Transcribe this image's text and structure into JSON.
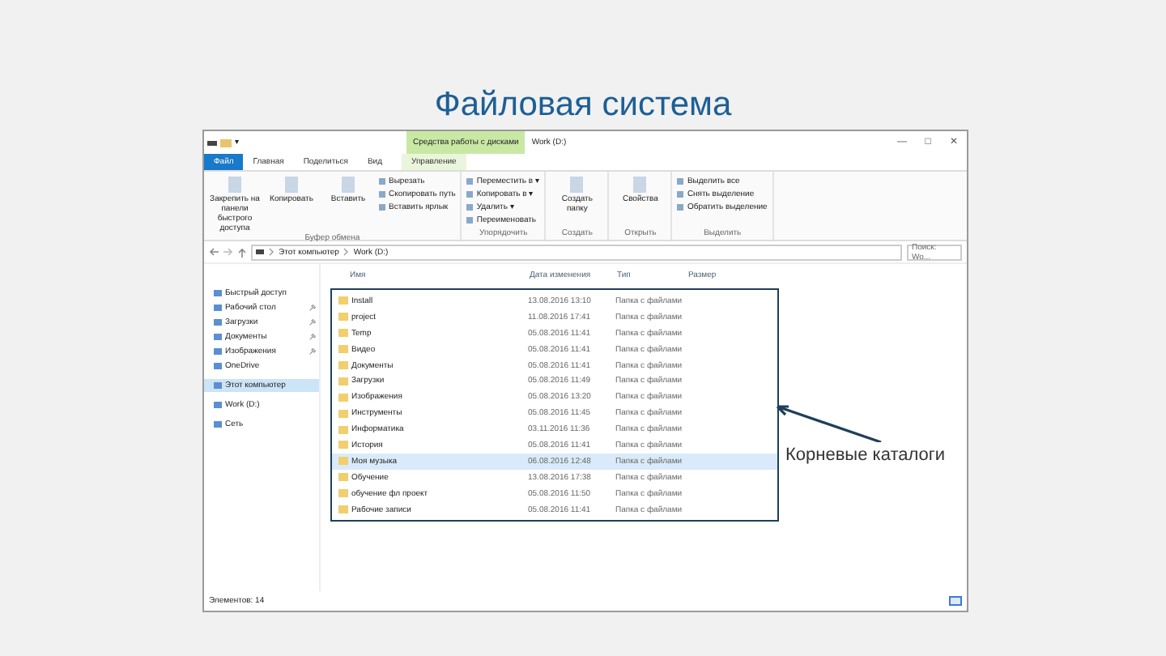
{
  "slide_title": "Файловая система",
  "window": {
    "quick_access": "▾",
    "context_tab": "Средства работы с дисками",
    "title": "Work (D:)",
    "controls": [
      "—",
      "□",
      "✕"
    ]
  },
  "tabs": [
    {
      "label": "Файл",
      "selected": true
    },
    {
      "label": "Главная",
      "selected": false
    },
    {
      "label": "Поделиться",
      "selected": false
    },
    {
      "label": "Вид",
      "selected": false
    },
    {
      "label": "Управление",
      "selected": false
    }
  ],
  "ribbon": [
    {
      "group": "Буфер обмена",
      "large": [
        "Закрепить на панели быстрого доступа",
        "Копировать",
        "Вставить"
      ],
      "small": [
        "Вырезать",
        "Скопировать путь",
        "Вставить ярлык"
      ]
    },
    {
      "group": "Упорядочить",
      "small": [
        "Переместить в ▾",
        "Копировать в ▾",
        "Удалить ▾",
        "Переименовать"
      ]
    },
    {
      "group": "Создать",
      "large": [
        "Создать папку"
      ]
    },
    {
      "group": "Открыть",
      "large": [
        "Свойства"
      ]
    },
    {
      "group": "Выделить",
      "small": [
        "Выделить все",
        "Снять выделение",
        "Обратить выделение"
      ]
    }
  ],
  "address": {
    "path": [
      "Этот компьютер",
      "Work (D:)"
    ],
    "search_placeholder": "Поиск: Wo..."
  },
  "navigation": [
    {
      "label": "Быстрый доступ",
      "selected": false,
      "pinned": false
    },
    {
      "label": "Рабочий стол",
      "selected": false,
      "pinned": true
    },
    {
      "label": "Загрузки",
      "selected": false,
      "pinned": true
    },
    {
      "label": "Документы",
      "selected": false,
      "pinned": true
    },
    {
      "label": "Изображения",
      "selected": false,
      "pinned": true
    },
    {
      "label": "OneDrive",
      "selected": false,
      "pinned": false
    },
    {
      "label": "Этот компьютер",
      "selected": true,
      "pinned": false
    },
    {
      "label": "Work (D:)",
      "selected": false,
      "pinned": false
    },
    {
      "label": "Сеть",
      "selected": false,
      "pinned": false
    }
  ],
  "table": {
    "columns": [
      "Имя",
      "Дата изменения",
      "Тип",
      "Размер"
    ],
    "rows": [
      {
        "name": "Install",
        "date": "13.08.2016 13:10",
        "type": "Папка с файлами",
        "selected": false
      },
      {
        "name": "project",
        "date": "11.08.2016 17:41",
        "type": "Папка с файлами",
        "selected": false
      },
      {
        "name": "Temp",
        "date": "05.08.2016 11:41",
        "type": "Папка с файлами",
        "selected": false
      },
      {
        "name": "Видео",
        "date": "05.08.2016 11:41",
        "type": "Папка с файлами",
        "selected": false
      },
      {
        "name": "Документы",
        "date": "05.08.2016 11:41",
        "type": "Папка с файлами",
        "selected": false
      },
      {
        "name": "Загрузки",
        "date": "05.08.2016 11:49",
        "type": "Папка с файлами",
        "selected": false
      },
      {
        "name": "Изображения",
        "date": "05.08.2016 13:20",
        "type": "Папка с файлами",
        "selected": false
      },
      {
        "name": "Инструменты",
        "date": "05.08.2016 11:45",
        "type": "Папка с файлами",
        "selected": false
      },
      {
        "name": "Информатика",
        "date": "03.11.2016 11:36",
        "type": "Папка с файлами",
        "selected": false
      },
      {
        "name": "История",
        "date": "05.08.2016 11:41",
        "type": "Папка с файлами",
        "selected": false
      },
      {
        "name": "Моя музыка",
        "date": "06.08.2016 12:48",
        "type": "Папка с файлами",
        "selected": true
      },
      {
        "name": "Обучение",
        "date": "13.08.2016 17:38",
        "type": "Папка с файлами",
        "selected": false
      },
      {
        "name": "обучение фл проект",
        "date": "05.08.2016 11:50",
        "type": "Папка с файлами",
        "selected": false
      },
      {
        "name": "Рабочие записи",
        "date": "05.08.2016 11:41",
        "type": "Папка с файлами",
        "selected": false
      }
    ]
  },
  "status_bar": "Элементов: 14",
  "annotation": "Корневые каталоги"
}
